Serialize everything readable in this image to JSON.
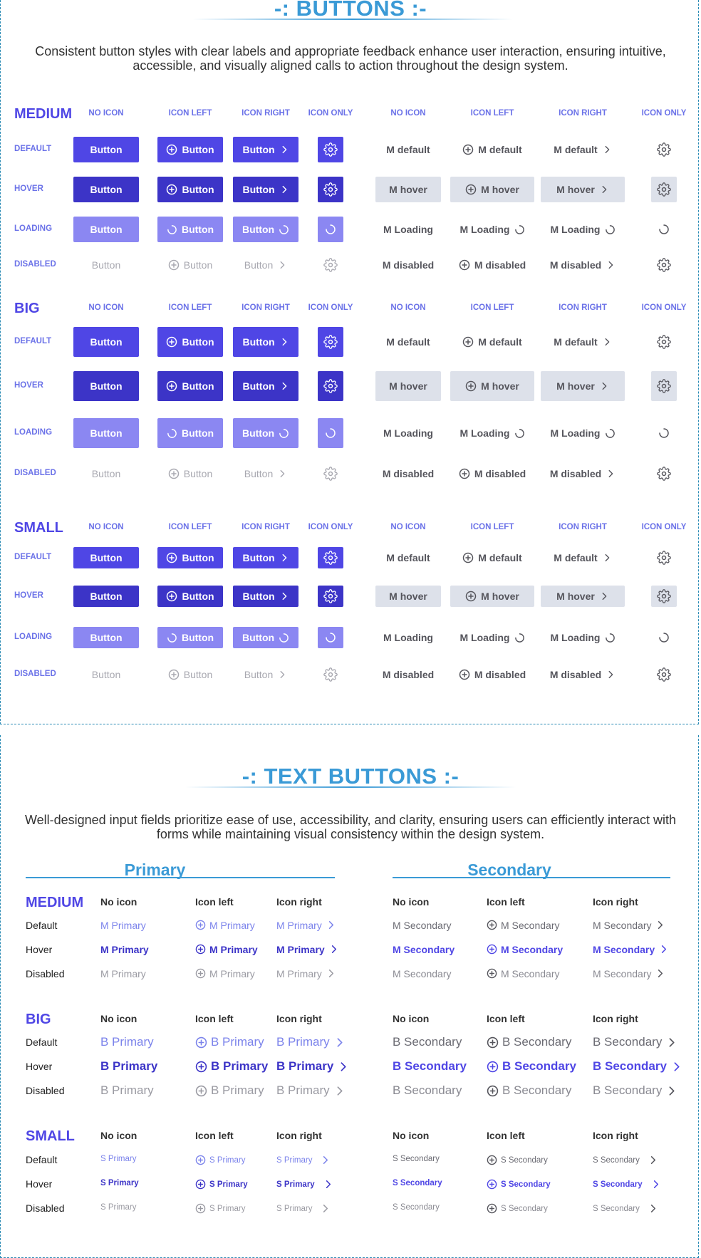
{
  "buttons": {
    "title": "-: BUTTONS :-",
    "description": "Consistent button styles with clear labels and appropriate feedback enhance user interaction, ensuring intuitive, accessible, and visually aligned calls to action throughout the design system.",
    "columns": [
      "NO ICON",
      "ICON LEFT",
      "ICON RIGHT",
      "ICON ONLY",
      "NO ICON",
      "ICON LEFT",
      "ICON RIGHT",
      "ICON ONLY"
    ],
    "states": [
      "DEFAULT",
      "HOVER",
      "LOADING",
      "DISABLED"
    ],
    "sizes": [
      "MEDIUM",
      "BIG",
      "SMALL"
    ],
    "primary_label": "Button",
    "secondary_labels": {
      "default": "M default",
      "hover": "M hover",
      "loading": "M Loading",
      "disabled": "M disabled"
    },
    "colors": {
      "primary_default": "#4f46e5",
      "primary_hover": "#3c34c7",
      "primary_loading": "#8b87f2",
      "secondary_hover_bg": "#dde1ea",
      "accent": "#3a9ad6"
    }
  },
  "text_buttons": {
    "title": "-: TEXT BUTTONS :-",
    "description": "Well-designed input fields prioritize ease of use, accessibility, and clarity, ensuring users can efficiently interact with forms while maintaining visual consistency within the design system.",
    "primary_heading": "Primary",
    "secondary_heading": "Secondary",
    "columns": [
      "No icon",
      "Icon left",
      "Icon right"
    ],
    "states": [
      "Default",
      "Hover",
      "Disabled"
    ],
    "sizes": [
      "MEDIUM",
      "BIG",
      "SMALL"
    ],
    "labels": {
      "medium_primary": "M Primary",
      "medium_secondary": "M Secondary",
      "big_primary": "B Primary",
      "big_secondary": "B Secondary",
      "small_primary": "S Primary",
      "small_secondary": "S Secondary"
    },
    "colors": {
      "primary_default": "#7b83eb",
      "primary_hover": "#3c34c7",
      "primary_disabled": "#9a9aa2",
      "secondary_default": "#6b6b73",
      "secondary_hover": "#4f46e5",
      "secondary_disabled": "#8a8a92"
    }
  }
}
